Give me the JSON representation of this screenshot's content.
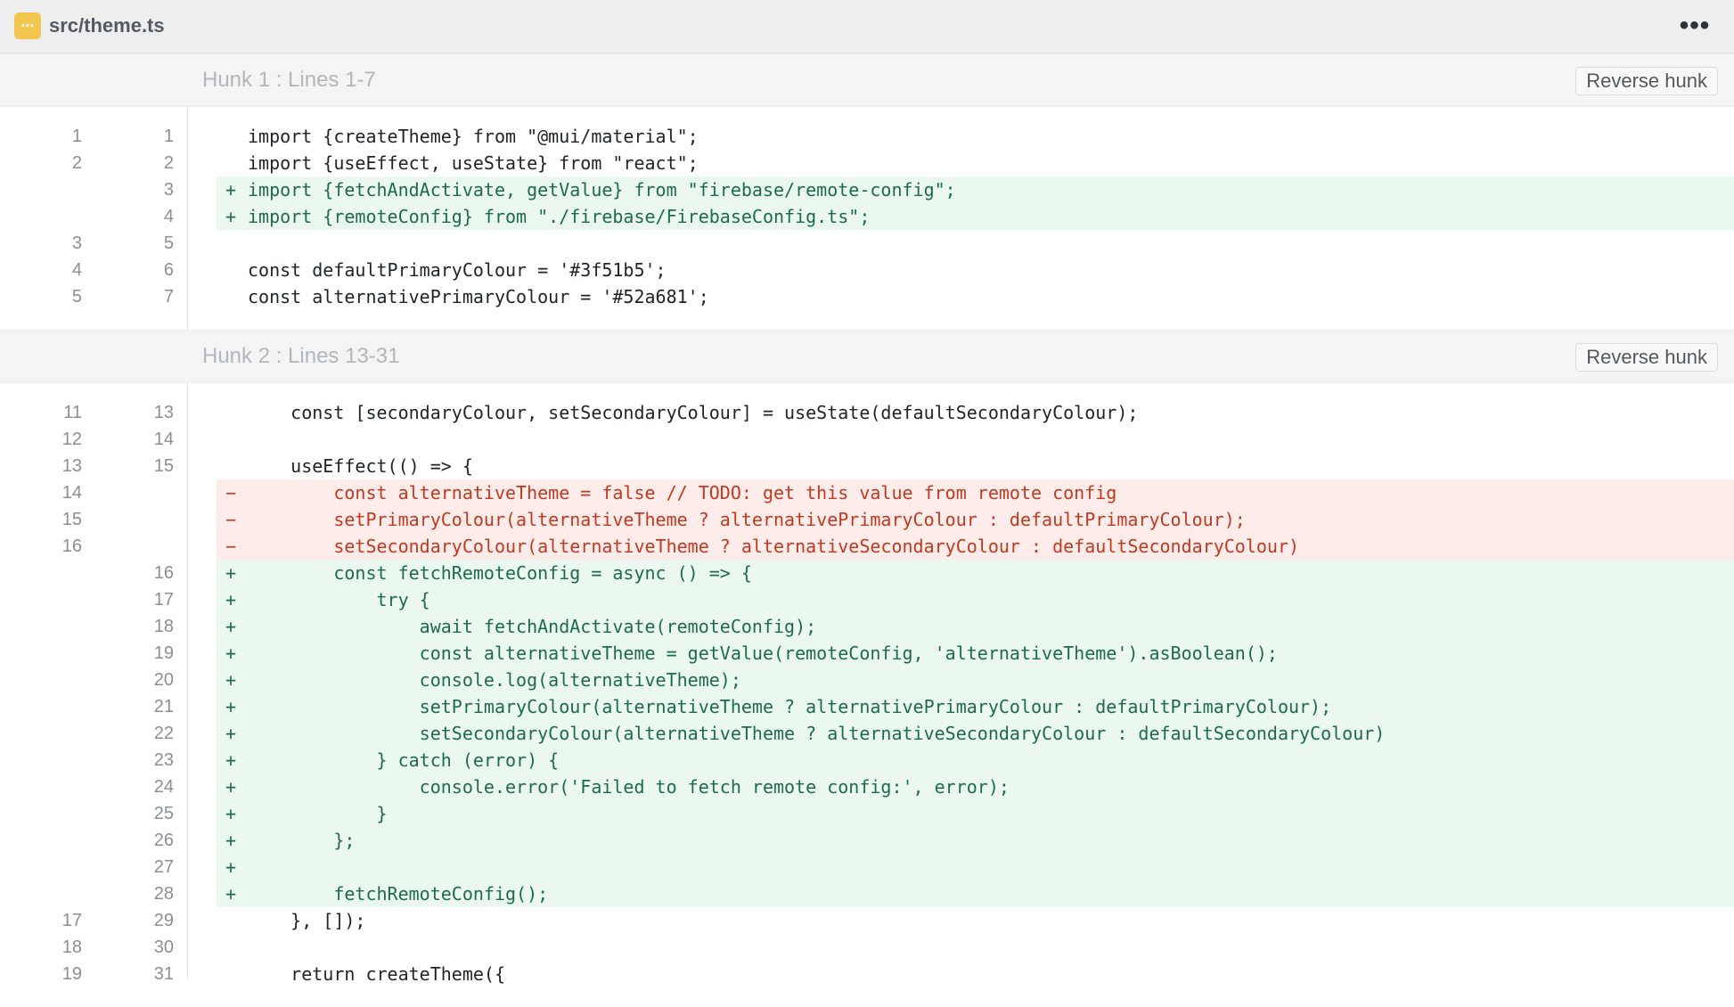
{
  "file": {
    "name": "src/theme.ts",
    "icon": "file-ts-icon"
  },
  "colors": {
    "file_icon": "#f2c64f",
    "added_bg": "#eaf8f0",
    "added_text": "#1e6b4a",
    "removed_bg": "#fdecea",
    "removed_text": "#c2391f"
  },
  "hunks": [
    {
      "title": "Hunk 1 : Lines 1-7",
      "reverse_label": "Reverse hunk",
      "lines": [
        {
          "old": "1",
          "new": "1",
          "type": "context",
          "marker": "",
          "code": "import {createTheme} from \"@mui/material\";"
        },
        {
          "old": "2",
          "new": "2",
          "type": "context",
          "marker": "",
          "code": "import {useEffect, useState} from \"react\";"
        },
        {
          "old": "",
          "new": "3",
          "type": "add",
          "marker": "+",
          "code": "import {fetchAndActivate, getValue} from \"firebase/remote-config\";"
        },
        {
          "old": "",
          "new": "4",
          "type": "add",
          "marker": "+",
          "code": "import {remoteConfig} from \"./firebase/FirebaseConfig.ts\";"
        },
        {
          "old": "3",
          "new": "5",
          "type": "context",
          "marker": "",
          "code": ""
        },
        {
          "old": "4",
          "new": "6",
          "type": "context",
          "marker": "",
          "code": "const defaultPrimaryColour = '#3f51b5';"
        },
        {
          "old": "5",
          "new": "7",
          "type": "context",
          "marker": "",
          "code": "const alternativePrimaryColour = '#52a681';"
        }
      ]
    },
    {
      "title": "Hunk 2 : Lines 13-31",
      "reverse_label": "Reverse hunk",
      "lines": [
        {
          "old": "11",
          "new": "13",
          "type": "context",
          "marker": "",
          "code": "    const [secondaryColour, setSecondaryColour] = useState(defaultSecondaryColour);"
        },
        {
          "old": "12",
          "new": "14",
          "type": "context",
          "marker": "",
          "code": ""
        },
        {
          "old": "13",
          "new": "15",
          "type": "context",
          "marker": "",
          "code": "    useEffect(() => {"
        },
        {
          "old": "14",
          "new": "",
          "type": "del",
          "marker": "−",
          "code": "        const alternativeTheme = false // TODO: get this value from remote config"
        },
        {
          "old": "15",
          "new": "",
          "type": "del",
          "marker": "−",
          "code": "        setPrimaryColour(alternativeTheme ? alternativePrimaryColour : defaultPrimaryColour);"
        },
        {
          "old": "16",
          "new": "",
          "type": "del",
          "marker": "−",
          "code": "        setSecondaryColour(alternativeTheme ? alternativeSecondaryColour : defaultSecondaryColour)"
        },
        {
          "old": "",
          "new": "16",
          "type": "add",
          "marker": "+",
          "code": "        const fetchRemoteConfig = async () => {"
        },
        {
          "old": "",
          "new": "17",
          "type": "add",
          "marker": "+",
          "code": "            try {"
        },
        {
          "old": "",
          "new": "18",
          "type": "add",
          "marker": "+",
          "code": "                await fetchAndActivate(remoteConfig);"
        },
        {
          "old": "",
          "new": "19",
          "type": "add",
          "marker": "+",
          "code": "                const alternativeTheme = getValue(remoteConfig, 'alternativeTheme').asBoolean();"
        },
        {
          "old": "",
          "new": "20",
          "type": "add",
          "marker": "+",
          "code": "                console.log(alternativeTheme);"
        },
        {
          "old": "",
          "new": "21",
          "type": "add",
          "marker": "+",
          "code": "                setPrimaryColour(alternativeTheme ? alternativePrimaryColour : defaultPrimaryColour);"
        },
        {
          "old": "",
          "new": "22",
          "type": "add",
          "marker": "+",
          "code": "                setSecondaryColour(alternativeTheme ? alternativeSecondaryColour : defaultSecondaryColour)"
        },
        {
          "old": "",
          "new": "23",
          "type": "add",
          "marker": "+",
          "code": "            } catch (error) {"
        },
        {
          "old": "",
          "new": "24",
          "type": "add",
          "marker": "+",
          "code": "                console.error('Failed to fetch remote config:', error);"
        },
        {
          "old": "",
          "new": "25",
          "type": "add",
          "marker": "+",
          "code": "            }"
        },
        {
          "old": "",
          "new": "26",
          "type": "add",
          "marker": "+",
          "code": "        };"
        },
        {
          "old": "",
          "new": "27",
          "type": "add",
          "marker": "+",
          "code": ""
        },
        {
          "old": "",
          "new": "28",
          "type": "add",
          "marker": "+",
          "code": "        fetchRemoteConfig();"
        },
        {
          "old": "17",
          "new": "29",
          "type": "context",
          "marker": "",
          "code": "    }, []);"
        },
        {
          "old": "18",
          "new": "30",
          "type": "context",
          "marker": "",
          "code": ""
        },
        {
          "old": "19",
          "new": "31",
          "type": "context",
          "marker": "",
          "code": "    return createTheme({"
        }
      ]
    }
  ]
}
